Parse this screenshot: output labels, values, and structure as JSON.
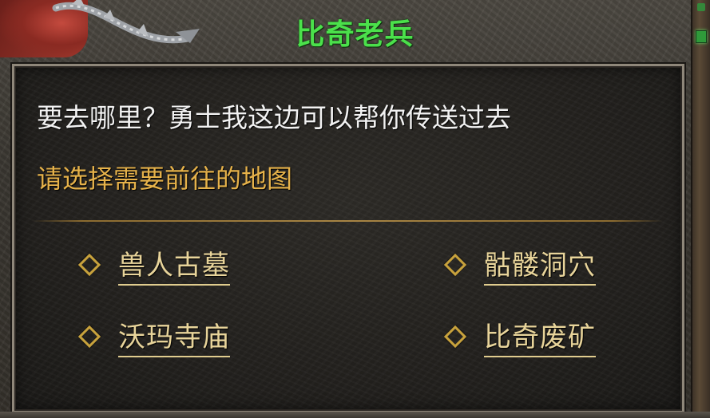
{
  "window": {
    "title": "比奇老兵"
  },
  "dialog": {
    "message": "要去哪里？勇士我这边可以帮你传送过去",
    "prompt": "请选择需要前往的地图"
  },
  "destinations": [
    {
      "label": "兽人古墓"
    },
    {
      "label": "骷髅洞穴"
    },
    {
      "label": "沃玛寺庙"
    },
    {
      "label": "比奇废矿"
    }
  ],
  "colors": {
    "title": "#4be04b",
    "message": "#f2f2f2",
    "prompt": "#e6b24a",
    "option": "#e8d49a",
    "bullet": "#c8a23c"
  },
  "icons": {
    "emblem": "dragon-emblem",
    "bullet": "diamond-bullet-icon",
    "status": "green-gem-icon"
  }
}
